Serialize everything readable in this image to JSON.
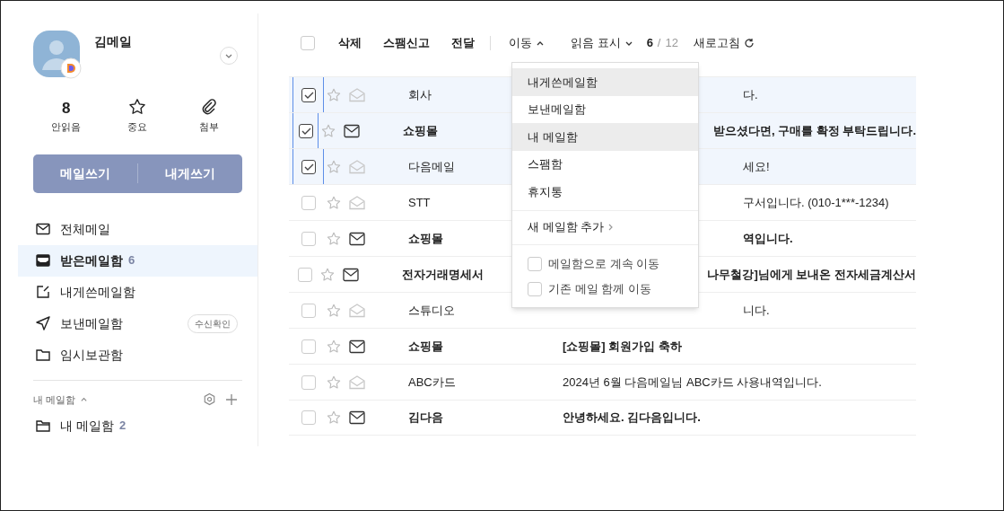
{
  "profile": {
    "name": "김메일",
    "stats": [
      {
        "kind": "count",
        "value": "8",
        "label": "안읽음"
      },
      {
        "kind": "star",
        "label": "중요"
      },
      {
        "kind": "clip",
        "label": "첨부"
      }
    ]
  },
  "compose": [
    "메일쓰기",
    "내게쓰기"
  ],
  "sidebar": {
    "items": [
      {
        "kind": "all",
        "label": "전체메일",
        "selected": false
      },
      {
        "kind": "inbox",
        "label": "받은메일함",
        "count": "6",
        "selected": true
      },
      {
        "kind": "self",
        "label": "내게쓴메일함",
        "selected": false
      },
      {
        "kind": "sent",
        "label": "보낸메일함",
        "badge": "수신확인",
        "selected": false
      },
      {
        "kind": "draft",
        "label": "임시보관함",
        "selected": false
      }
    ],
    "section": {
      "title": "내 메일함",
      "expanded": true,
      "folders": [
        {
          "label": "내 메일함",
          "count": "2"
        }
      ]
    }
  },
  "toolbar": {
    "select_all": {
      "checked": false
    },
    "actions": [
      "삭제",
      "스팸신고",
      "전달"
    ],
    "move": {
      "label": "이동",
      "expanded": true
    },
    "read_mark": "읽음 표시",
    "page": {
      "current": "6",
      "separator": "/",
      "total": "12"
    },
    "refresh": "새로고침"
  },
  "menu": {
    "items": [
      {
        "label": "내게쓴메일함",
        "highlighted": true
      },
      {
        "label": "보낸메일함",
        "highlighted": false
      },
      {
        "label": "내 메일함",
        "highlighted": true
      },
      {
        "label": "스팸함",
        "highlighted": false
      },
      {
        "label": "휴지통",
        "highlighted": false
      }
    ],
    "add": "새 메일함 추가",
    "options": [
      {
        "label": "메일함으로 계속 이동",
        "checked": false
      },
      {
        "label": "기존 메일 함께 이동",
        "checked": false
      }
    ]
  },
  "rows": [
    {
      "checked": true,
      "unread": false,
      "sender": "회사",
      "subject": "다.",
      "kind": "under_menu"
    },
    {
      "checked": true,
      "unread": true,
      "sender": "쇼핑몰",
      "subject": "받으셨다면, 구매를 확정 부탁드립니다.",
      "kind": "under_menu"
    },
    {
      "checked": true,
      "unread": false,
      "sender": "다음메일",
      "subject": "세요!",
      "kind": "under_menu"
    },
    {
      "checked": false,
      "unread": false,
      "sender": "STT",
      "subject": "구서입니다. (010-1***-1234)",
      "kind": "under_menu"
    },
    {
      "checked": false,
      "unread": true,
      "sender": "쇼핑몰",
      "subject": "역입니다.",
      "kind": "under_menu"
    },
    {
      "checked": false,
      "unread": true,
      "sender": "전자거래명세서",
      "subject": "나무철강]님에게 보내온 전자세금계산서",
      "kind": "under_menu"
    },
    {
      "checked": false,
      "unread": false,
      "sender": "스튜디오",
      "subject": "니다.",
      "kind": "under_menu"
    },
    {
      "checked": false,
      "unread": true,
      "sender": "쇼핑몰",
      "subject": "[쇼핑몰] 회원가입 축하",
      "kind": "plain"
    },
    {
      "checked": false,
      "unread": false,
      "sender": "ABC카드",
      "subject": "2024년 6월 다음메일님 ABC카드 사용내역입니다.",
      "kind": "plain"
    },
    {
      "checked": false,
      "unread": true,
      "sender": "김다음",
      "subject": "안녕하세요. 김다음입니다.",
      "kind": "plain"
    }
  ]
}
